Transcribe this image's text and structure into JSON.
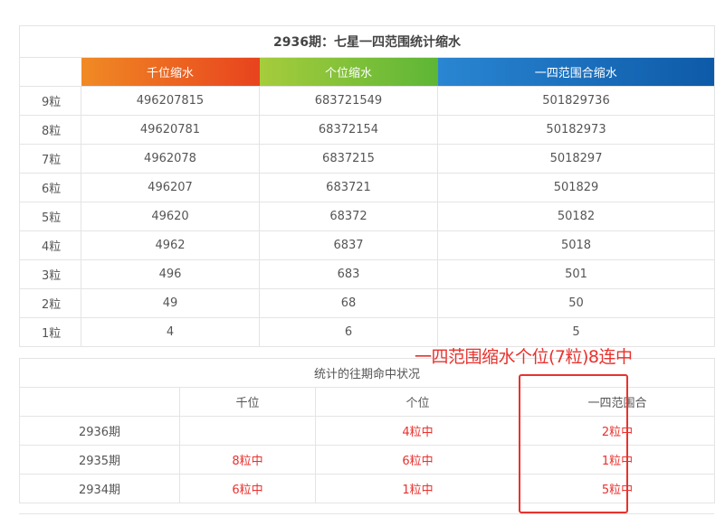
{
  "stats_table": {
    "title": "2936期：七星一四范围统计缩水",
    "headers": [
      "千位缩水",
      "个位缩水",
      "一四范围合缩水"
    ],
    "rows": [
      {
        "label": "9粒",
        "values": [
          "496207815",
          "683721549",
          "501829736"
        ]
      },
      {
        "label": "8粒",
        "values": [
          "49620781",
          "68372154",
          "50182973"
        ]
      },
      {
        "label": "7粒",
        "values": [
          "4962078",
          "6837215",
          "5018297"
        ]
      },
      {
        "label": "6粒",
        "values": [
          "496207",
          "683721",
          "501829"
        ]
      },
      {
        "label": "5粒",
        "values": [
          "49620",
          "68372",
          "50182"
        ]
      },
      {
        "label": "4粒",
        "values": [
          "4962",
          "6837",
          "5018"
        ]
      },
      {
        "label": "3粒",
        "values": [
          "496",
          "683",
          "501"
        ]
      },
      {
        "label": "2粒",
        "values": [
          "49",
          "68",
          "50"
        ]
      },
      {
        "label": "1粒",
        "values": [
          "4",
          "6",
          "5"
        ]
      }
    ]
  },
  "history_table": {
    "caption": "统计的往期命中状况",
    "headers": [
      "",
      "千位",
      "个位",
      "一四范围合"
    ],
    "rows": [
      {
        "issue": "2936期",
        "cells": [
          "",
          "4粒中",
          "2粒中"
        ]
      },
      {
        "issue": "2935期",
        "cells": [
          "8粒中",
          "6粒中",
          "1粒中"
        ]
      },
      {
        "issue": "2934期",
        "cells": [
          "6粒中",
          "1粒中",
          "5粒中"
        ]
      }
    ]
  },
  "annotation": {
    "text": "一四范围缩水个位(7粒)8连中",
    "color": "#e8322e"
  },
  "colors": {
    "thousands_header": "#ea5a20",
    "units_header": "#7dc03a",
    "range_header": "#1a6fbd",
    "hit_text": "#e8322e"
  }
}
